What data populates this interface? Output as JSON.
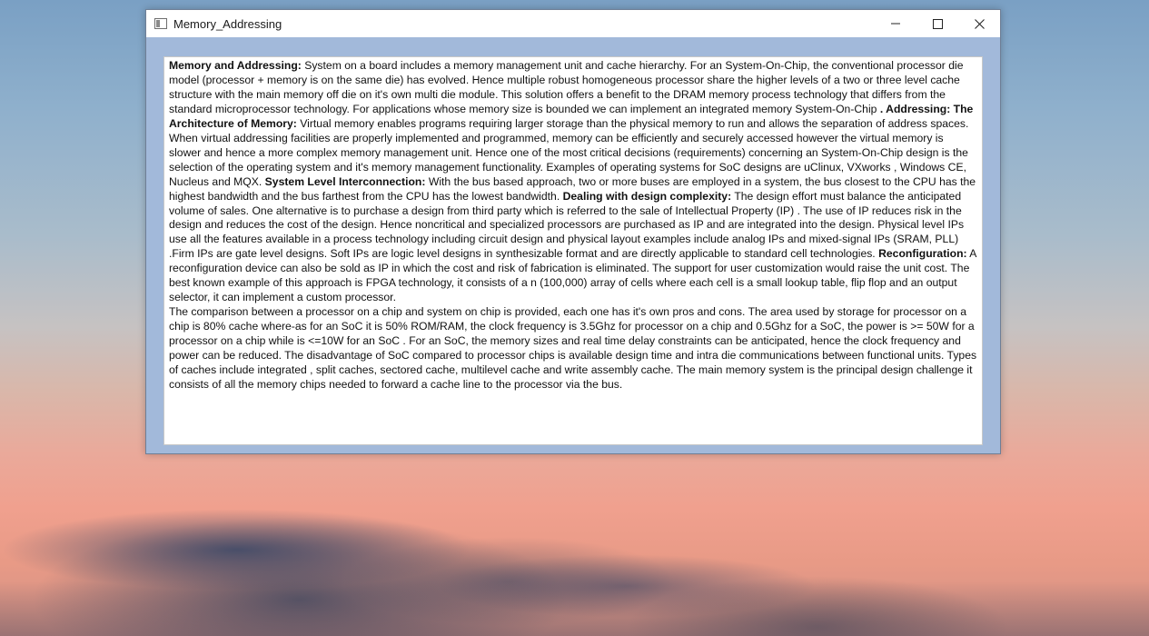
{
  "window": {
    "title": "Memory_Addressing",
    "controls": {
      "minimize": "minimize",
      "maximize": "maximize",
      "close": "close"
    }
  },
  "document": {
    "paragraph1": [
      {
        "bold": true,
        "text": "Memory and Addressing:"
      },
      {
        "bold": false,
        "text": "   System on  a board includes  a memory management unit and cache hierarchy.  For an System-On-Chip, the conventional processor die model (processor + memory is on the same die) has evolved. Hence multiple robust homogeneous processor share the higher levels of a two or three level cache structure with the main memory off die on it's own multi die module. This solution offers a benefit to the DRAM memory process technology that differs from the standard microprocessor technology.  For applications whose memory size is bounded we can implement an integrated memory System-On-Chip  "
      },
      {
        "bold": true,
        "text": ". Addressing: The Architecture of Memory:"
      },
      {
        "bold": false,
        "text": "   Virtual memory enables programs requiring larger storage than the physical memory to run and allows the separation of address spaces.  When virtual addressing facilities are properly implemented and programmed, memory can be efficiently and securely accessed however the virtual memory is slower and hence a more complex memory management unit. Hence one of the most critical decisions (requirements) concerning an System-On-Chip design is the selection of the operating system and it's memory management functionality.    Examples of operating systems for SoC designs are uClinux, VXworks , Windows CE, Nucleus and MQX.     "
      },
      {
        "bold": true,
        "text": "System Level Interconnection:"
      },
      {
        "bold": false,
        "text": "   With the bus based approach, two or more buses are employed in a system, the bus closest to the CPU has the highest bandwidth and the bus farthest from the CPU has the lowest bandwidth.    "
      },
      {
        "bold": true,
        "text": "Dealing with design complexity:"
      },
      {
        "bold": false,
        "text": "   The design effort must balance the anticipated volume of sales. One alternative is to purchase a design from third party which is referred to the sale of Intellectual Property (IP) . The use of IP reduces risk in the design and reduces the cost of the design. Hence noncritical and specialized processors are purchased as IP and are integrated into the design. Physical level IPs use all the features available in a process technology including circuit design and physical layout examples include analog IPs and mixed-signal IPs (SRAM, PLL) .Firm IPs are gate level designs. Soft IPs are logic level designs in synthesizable format and are directly applicable to standard cell technologies.   "
      },
      {
        "bold": true,
        "text": "Reconfiguration:"
      },
      {
        "bold": false,
        "text": "   A reconfiguration device can also be sold as IP in which the cost and risk of fabrication is eliminated. The support for user customization would raise the unit cost.   The best known example of this approach is FPGA technology, it consists of a n (100,000) array of cells where each cell is a small lookup table, flip flop and an output selector, it can implement a custom processor."
      }
    ],
    "paragraph2": "The comparison between a processor on a chip and  system on  chip is provided, each one has it's own pros and cons. The area used by storage for processor on a chip is 80% cache where-as for an SoC it is 50% ROM/RAM, the clock frequency is 3.5Ghz for  processor on  a chip and 0.5Ghz for a SoC, the power is >= 50W for a processor on a  chip while is <=10W for an SoC .  For an SoC, the memory sizes and real time delay constraints can be anticipated, hence the clock frequency and power can be reduced.  The disadvantage of SoC compared to processor chips is available design time and intra die communications between functional units.  Types of caches include integrated , split caches, sectored cache, multilevel cache and write assembly cache. The main memory system is the principal design challenge it consists of all the memory chips needed to forward a cache line to the processor via the bus."
  }
}
